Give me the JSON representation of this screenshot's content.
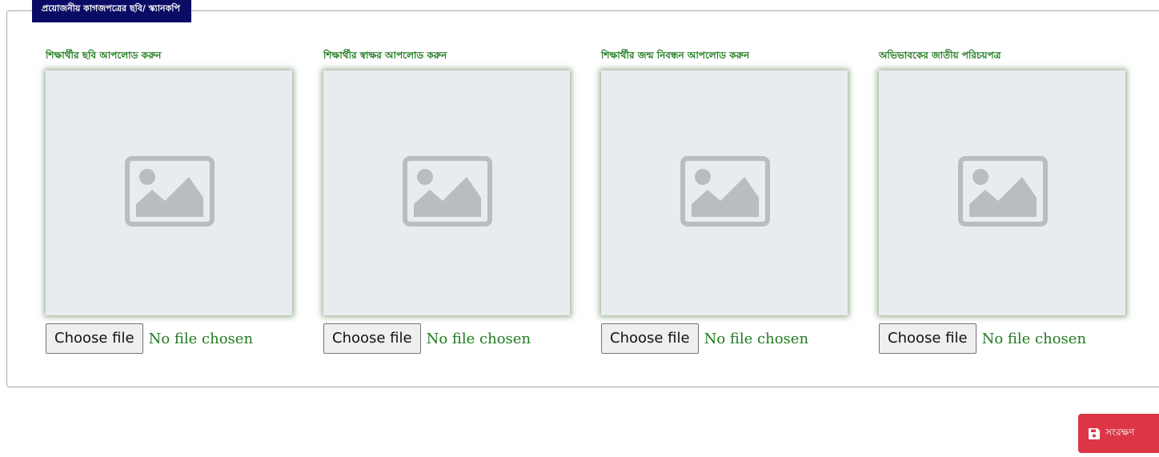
{
  "section": {
    "legend": "প্রয়োজনীয় কাগজপত্রের ছবি/ স্ক্যানকপি"
  },
  "uploads": [
    {
      "label": "শিক্ষার্থীর ছবি আপলোড করুন",
      "button": "Choose file",
      "status": "No file chosen"
    },
    {
      "label": "শিক্ষার্থীর স্বাক্ষর আপলোড করুন",
      "button": "Choose file",
      "status": "No file chosen"
    },
    {
      "label": "শিক্ষার্থীর জন্ম নিবন্ধন আপলোড করুন",
      "button": "Choose file",
      "status": "No file chosen"
    },
    {
      "label": "অভিভাবকের জাতীয় পরিচয়পত্র",
      "button": "Choose file",
      "status": "No file chosen"
    }
  ],
  "actions": {
    "save_label": "সংরক্ষণ",
    "save_icon": "save-icon"
  },
  "colors": {
    "legend_bg": "#0b0b66",
    "label_green": "#1f7a1f",
    "save_red": "#dc3545",
    "preview_bg": "#e8ecef"
  }
}
